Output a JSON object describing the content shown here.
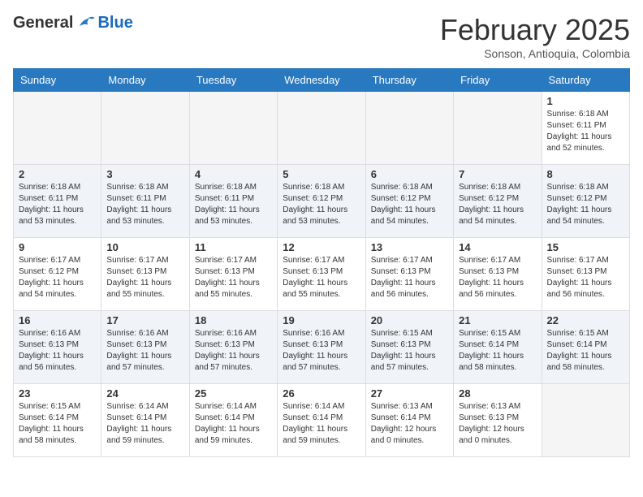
{
  "header": {
    "logo_general": "General",
    "logo_blue": "Blue",
    "month_title": "February 2025",
    "location": "Sonson, Antioquia, Colombia"
  },
  "weekdays": [
    "Sunday",
    "Monday",
    "Tuesday",
    "Wednesday",
    "Thursday",
    "Friday",
    "Saturday"
  ],
  "weeks": [
    {
      "shade": "odd",
      "days": [
        {
          "num": "",
          "info": "",
          "empty": true
        },
        {
          "num": "",
          "info": "",
          "empty": true
        },
        {
          "num": "",
          "info": "",
          "empty": true
        },
        {
          "num": "",
          "info": "",
          "empty": true
        },
        {
          "num": "",
          "info": "",
          "empty": true
        },
        {
          "num": "",
          "info": "",
          "empty": true
        },
        {
          "num": "1",
          "info": "Sunrise: 6:18 AM\nSunset: 6:11 PM\nDaylight: 11 hours\nand 52 minutes.",
          "empty": false
        }
      ]
    },
    {
      "shade": "even",
      "days": [
        {
          "num": "2",
          "info": "Sunrise: 6:18 AM\nSunset: 6:11 PM\nDaylight: 11 hours\nand 53 minutes.",
          "empty": false
        },
        {
          "num": "3",
          "info": "Sunrise: 6:18 AM\nSunset: 6:11 PM\nDaylight: 11 hours\nand 53 minutes.",
          "empty": false
        },
        {
          "num": "4",
          "info": "Sunrise: 6:18 AM\nSunset: 6:11 PM\nDaylight: 11 hours\nand 53 minutes.",
          "empty": false
        },
        {
          "num": "5",
          "info": "Sunrise: 6:18 AM\nSunset: 6:12 PM\nDaylight: 11 hours\nand 53 minutes.",
          "empty": false
        },
        {
          "num": "6",
          "info": "Sunrise: 6:18 AM\nSunset: 6:12 PM\nDaylight: 11 hours\nand 54 minutes.",
          "empty": false
        },
        {
          "num": "7",
          "info": "Sunrise: 6:18 AM\nSunset: 6:12 PM\nDaylight: 11 hours\nand 54 minutes.",
          "empty": false
        },
        {
          "num": "8",
          "info": "Sunrise: 6:18 AM\nSunset: 6:12 PM\nDaylight: 11 hours\nand 54 minutes.",
          "empty": false
        }
      ]
    },
    {
      "shade": "odd",
      "days": [
        {
          "num": "9",
          "info": "Sunrise: 6:17 AM\nSunset: 6:12 PM\nDaylight: 11 hours\nand 54 minutes.",
          "empty": false
        },
        {
          "num": "10",
          "info": "Sunrise: 6:17 AM\nSunset: 6:13 PM\nDaylight: 11 hours\nand 55 minutes.",
          "empty": false
        },
        {
          "num": "11",
          "info": "Sunrise: 6:17 AM\nSunset: 6:13 PM\nDaylight: 11 hours\nand 55 minutes.",
          "empty": false
        },
        {
          "num": "12",
          "info": "Sunrise: 6:17 AM\nSunset: 6:13 PM\nDaylight: 11 hours\nand 55 minutes.",
          "empty": false
        },
        {
          "num": "13",
          "info": "Sunrise: 6:17 AM\nSunset: 6:13 PM\nDaylight: 11 hours\nand 56 minutes.",
          "empty": false
        },
        {
          "num": "14",
          "info": "Sunrise: 6:17 AM\nSunset: 6:13 PM\nDaylight: 11 hours\nand 56 minutes.",
          "empty": false
        },
        {
          "num": "15",
          "info": "Sunrise: 6:17 AM\nSunset: 6:13 PM\nDaylight: 11 hours\nand 56 minutes.",
          "empty": false
        }
      ]
    },
    {
      "shade": "even",
      "days": [
        {
          "num": "16",
          "info": "Sunrise: 6:16 AM\nSunset: 6:13 PM\nDaylight: 11 hours\nand 56 minutes.",
          "empty": false
        },
        {
          "num": "17",
          "info": "Sunrise: 6:16 AM\nSunset: 6:13 PM\nDaylight: 11 hours\nand 57 minutes.",
          "empty": false
        },
        {
          "num": "18",
          "info": "Sunrise: 6:16 AM\nSunset: 6:13 PM\nDaylight: 11 hours\nand 57 minutes.",
          "empty": false
        },
        {
          "num": "19",
          "info": "Sunrise: 6:16 AM\nSunset: 6:13 PM\nDaylight: 11 hours\nand 57 minutes.",
          "empty": false
        },
        {
          "num": "20",
          "info": "Sunrise: 6:15 AM\nSunset: 6:13 PM\nDaylight: 11 hours\nand 57 minutes.",
          "empty": false
        },
        {
          "num": "21",
          "info": "Sunrise: 6:15 AM\nSunset: 6:14 PM\nDaylight: 11 hours\nand 58 minutes.",
          "empty": false
        },
        {
          "num": "22",
          "info": "Sunrise: 6:15 AM\nSunset: 6:14 PM\nDaylight: 11 hours\nand 58 minutes.",
          "empty": false
        }
      ]
    },
    {
      "shade": "odd",
      "days": [
        {
          "num": "23",
          "info": "Sunrise: 6:15 AM\nSunset: 6:14 PM\nDaylight: 11 hours\nand 58 minutes.",
          "empty": false
        },
        {
          "num": "24",
          "info": "Sunrise: 6:14 AM\nSunset: 6:14 PM\nDaylight: 11 hours\nand 59 minutes.",
          "empty": false
        },
        {
          "num": "25",
          "info": "Sunrise: 6:14 AM\nSunset: 6:14 PM\nDaylight: 11 hours\nand 59 minutes.",
          "empty": false
        },
        {
          "num": "26",
          "info": "Sunrise: 6:14 AM\nSunset: 6:14 PM\nDaylight: 11 hours\nand 59 minutes.",
          "empty": false
        },
        {
          "num": "27",
          "info": "Sunrise: 6:13 AM\nSunset: 6:14 PM\nDaylight: 12 hours\nand 0 minutes.",
          "empty": false
        },
        {
          "num": "28",
          "info": "Sunrise: 6:13 AM\nSunset: 6:13 PM\nDaylight: 12 hours\nand 0 minutes.",
          "empty": false
        },
        {
          "num": "",
          "info": "",
          "empty": true
        }
      ]
    }
  ]
}
